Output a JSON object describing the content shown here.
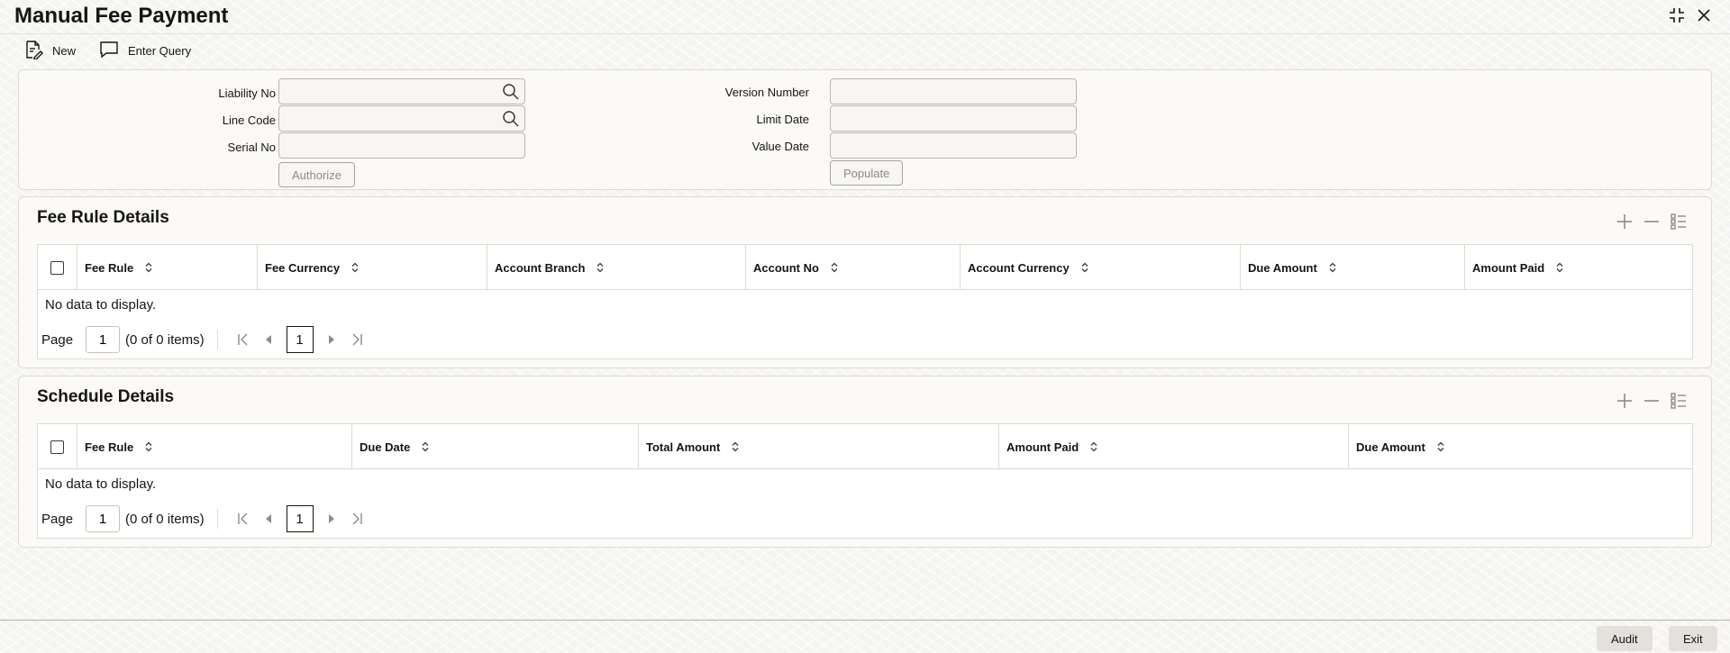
{
  "window": {
    "title": "Manual Fee Payment",
    "minimize_icon": "collapse-icon",
    "close_icon": "close-icon"
  },
  "toolbar": {
    "new_label": "New",
    "enter_query_label": "Enter Query"
  },
  "form": {
    "liability_no_label": "Liability No",
    "liability_no_value": "",
    "line_code_label": "Line Code",
    "line_code_value": "",
    "serial_no_label": "Serial No",
    "serial_no_value": "",
    "authorize_label": "Authorize",
    "version_number_label": "Version Number",
    "version_number_value": "",
    "limit_date_label": "Limit Date",
    "limit_date_value": "",
    "value_date_label": "Value Date",
    "value_date_value": "",
    "populate_label": "Populate"
  },
  "fee_rule_details": {
    "title": "Fee Rule Details",
    "columns": [
      "Fee Rule",
      "Fee Currency",
      "Account Branch",
      "Account No",
      "Account Currency",
      "Due Amount",
      "Amount Paid"
    ],
    "rows": [],
    "empty_text": "No data to display.",
    "page_label": "Page",
    "page_value": "1",
    "items_text": "(0 of 0 items)",
    "current_page": "1"
  },
  "schedule_details": {
    "title": "Schedule Details",
    "columns": [
      "Fee Rule",
      "Due Date",
      "Total Amount",
      "Amount Paid",
      "Due Amount"
    ],
    "rows": [],
    "empty_text": "No data to display.",
    "page_label": "Page",
    "page_value": "1",
    "items_text": "(0 of 0 items)",
    "current_page": "1"
  },
  "footer": {
    "audit_label": "Audit",
    "exit_label": "Exit"
  }
}
